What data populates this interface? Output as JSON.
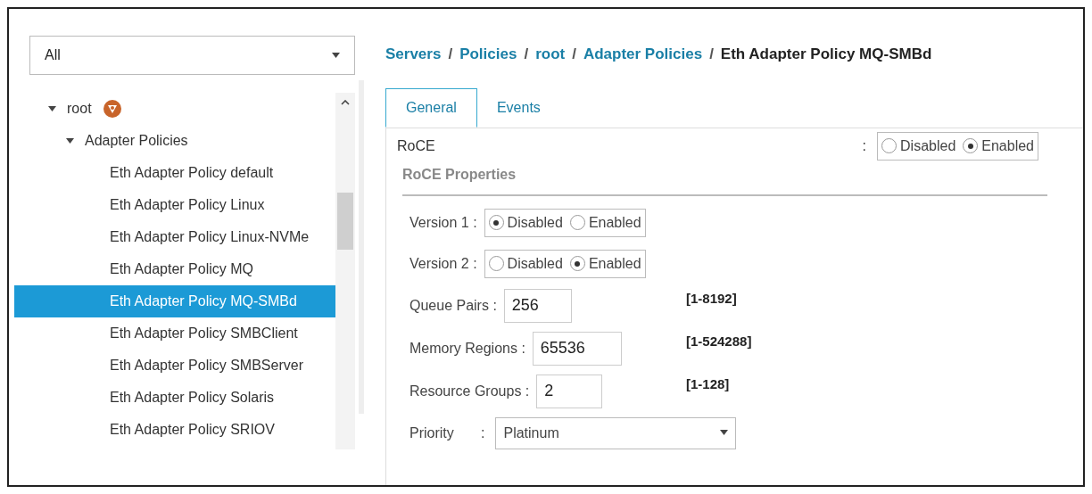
{
  "filter": {
    "value": "All"
  },
  "tree": [
    {
      "label": "root",
      "expanded": true,
      "children": [
        {
          "label": "Adapter Policies",
          "expanded": true,
          "children": [
            {
              "label": "Eth Adapter Policy default",
              "selected": false
            },
            {
              "label": "Eth Adapter Policy Linux",
              "selected": false
            },
            {
              "label": "Eth Adapter Policy Linux-NVMe",
              "selected": false
            },
            {
              "label": "Eth Adapter Policy MQ",
              "selected": false
            },
            {
              "label": "Eth Adapter Policy MQ-SMBd",
              "selected": true
            },
            {
              "label": "Eth Adapter Policy SMBClient",
              "selected": false
            },
            {
              "label": "Eth Adapter Policy SMBServer",
              "selected": false
            },
            {
              "label": "Eth Adapter Policy Solaris",
              "selected": false
            },
            {
              "label": "Eth Adapter Policy SRIOV",
              "selected": false
            }
          ]
        }
      ]
    }
  ],
  "breadcrumb": [
    {
      "label": "Servers",
      "link": true
    },
    {
      "label": "Policies",
      "link": true
    },
    {
      "label": "root",
      "link": true
    },
    {
      "label": "Adapter Policies",
      "link": true
    },
    {
      "label": "Eth Adapter Policy MQ-SMBd",
      "link": false
    }
  ],
  "separator": "/",
  "tabs": [
    {
      "label": "General",
      "selected": true
    },
    {
      "label": "Events",
      "selected": false
    }
  ],
  "roce": {
    "label": "RoCE",
    "colon": ":",
    "options": [
      {
        "label": "Disabled",
        "selected": false
      },
      {
        "label": "Enabled",
        "selected": true
      }
    ]
  },
  "section_title": "RoCE Properties",
  "fields": [
    {
      "kind": "radio",
      "label": "Version 1 :",
      "options": [
        {
          "label": "Disabled",
          "selected": true
        },
        {
          "label": "Enabled",
          "selected": false
        }
      ]
    },
    {
      "kind": "radio",
      "label": "Version 2 :",
      "options": [
        {
          "label": "Disabled",
          "selected": false
        },
        {
          "label": "Enabled",
          "selected": true
        }
      ]
    },
    {
      "kind": "number",
      "label": "Queue Pairs :",
      "value": "256",
      "range": "[1-8192]"
    },
    {
      "kind": "number",
      "label": "Memory Regions :",
      "value": "65536",
      "range": "[1-524288]"
    },
    {
      "kind": "number",
      "label": "Resource Groups :",
      "value": "2",
      "range": "[1-128]"
    },
    {
      "kind": "select",
      "label": "Priority",
      "colon": ":",
      "value": "Platinum"
    }
  ]
}
